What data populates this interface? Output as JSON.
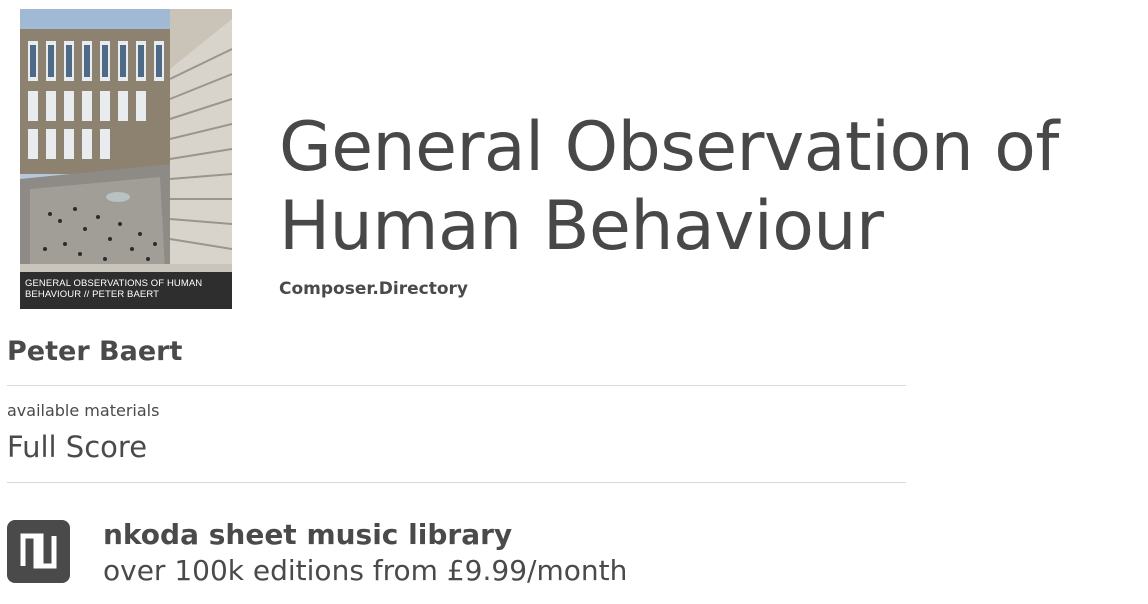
{
  "cover": {
    "caption_line1": "GENERAL OBSERVATIONS OF HUMAN",
    "caption_line2": "BEHAVIOUR // PETER BAERT"
  },
  "work": {
    "title": "General Observation of Human Behaviour",
    "source": "Composer.Directory",
    "composer": "Peter Baert"
  },
  "materials": {
    "label": "available materials",
    "value": "Full Score"
  },
  "promo": {
    "logo_icon": "nkoda-logo-icon",
    "title": "nkoda sheet music library",
    "subtitle": "over 100k editions from £9.99/month"
  },
  "colors": {
    "text": "#4a4a4a",
    "divider": "#d9d9d9",
    "caption_bg": "#2e2e2e"
  }
}
